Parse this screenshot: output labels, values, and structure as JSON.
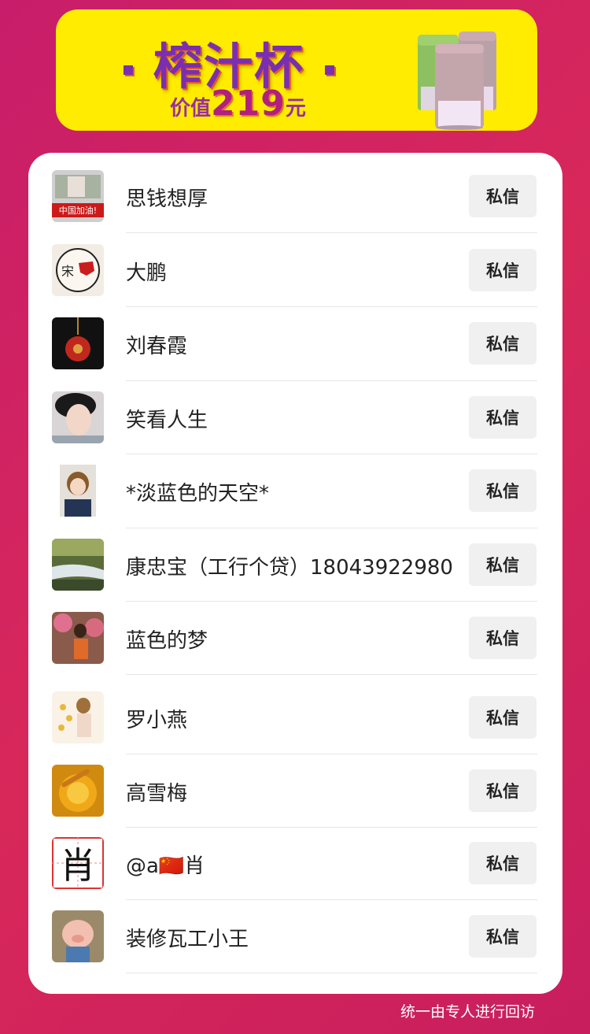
{
  "banner": {
    "title": "榨汁杯",
    "price_prefix": "价值",
    "price_value": "219",
    "price_suffix": "元"
  },
  "contacts": [
    {
      "name": "思钱想厚",
      "action": "私信"
    },
    {
      "name": "大鹏",
      "action": "私信"
    },
    {
      "name": "刘春霞",
      "action": "私信"
    },
    {
      "name": "笑看人生",
      "action": "私信"
    },
    {
      "name": "*淡蓝色的天空*",
      "action": "私信"
    },
    {
      "name": "康忠宝（工行个贷）18043922980",
      "action": "私信"
    },
    {
      "name": "蓝色的梦",
      "action": "私信"
    },
    {
      "name": "罗小燕",
      "action": "私信"
    },
    {
      "name": "高雪梅",
      "action": "私信"
    },
    {
      "name": "@a🇨🇳肖",
      "action": "私信"
    },
    {
      "name": "装修瓦工小王",
      "action": "私信"
    }
  ],
  "footer": {
    "note": "统一由专人进行回访"
  },
  "colors": {
    "background": "#d0235f",
    "banner": "#ffec00",
    "title_purple": "#7a2fb0",
    "button_bg": "#f0f0f0"
  }
}
